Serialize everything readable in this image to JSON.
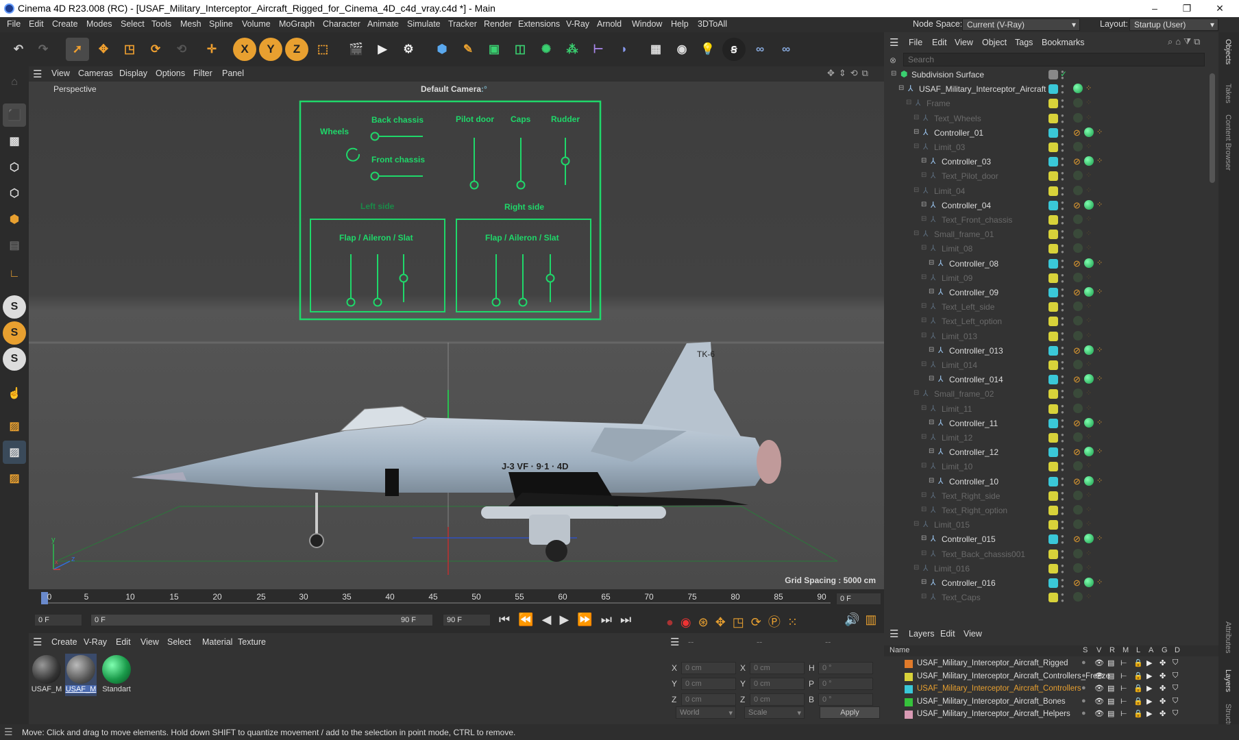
{
  "window": {
    "title": "Cinema 4D R23.008 (RC) - [USAF_Military_Interceptor_Aircraft_Rigged_for_Cinema_4D_c4d_vray.c4d *] - Main",
    "minimize": "–",
    "maximize": "❐",
    "close": "✕"
  },
  "menubar": {
    "items": [
      "File",
      "Edit",
      "Create",
      "Modes",
      "Select",
      "Tools",
      "Mesh",
      "Spline",
      "Volume",
      "MoGraph",
      "Character",
      "Animate",
      "Simulate",
      "Tracker",
      "Render",
      "Extensions",
      "V-Ray",
      "Arnold",
      "Window",
      "Help",
      "3DToAll"
    ],
    "node_space_label": "Node Space:",
    "node_space_value": "Current (V-Ray)",
    "layout_label": "Layout:",
    "layout_value": "Startup (User)"
  },
  "toolbar": {
    "axis_x": "X",
    "axis_y": "Y",
    "axis_z": "Z"
  },
  "lefttools": {
    "s1": "S",
    "s2": "S",
    "s3": "S"
  },
  "viewport": {
    "menu": [
      "View",
      "Cameras",
      "Display",
      "Options",
      "Filter",
      "Panel"
    ],
    "label": "Perspective",
    "camera": "Default Camera",
    "camera_suffix": ":°",
    "grid_spacing": "Grid Spacing : 5000 cm",
    "axis_y": "y",
    "axis_z": "z",
    "axis_x": "x",
    "rig": {
      "wheels": "Wheels",
      "back_chassis": "Back chassis",
      "front_chassis": "Front chassis",
      "pilot_door": "Pilot door",
      "caps": "Caps",
      "rudder": "Rudder",
      "left_side": "Left side",
      "right_side": "Right side",
      "flap_left": "Flap / Aileron / Slat",
      "flap_right": "Flap / Aileron / Slat"
    },
    "decals": {
      "tail": "TK-6",
      "fuselage": "J-3 VF · 9·1 · 4D"
    }
  },
  "timeline": {
    "ticks": [
      "0",
      "5",
      "10",
      "15",
      "20",
      "25",
      "30",
      "35",
      "40",
      "45",
      "50",
      "55",
      "60",
      "65",
      "70",
      "75",
      "80",
      "85",
      "90"
    ],
    "current_frame": "0 F"
  },
  "transport": {
    "start": "0 F",
    "range_start": "0 F",
    "range_end": "90 F",
    "end": "90 F"
  },
  "materials": {
    "menu": [
      "Create",
      "V-Ray",
      "Edit",
      "View",
      "Select",
      "Material",
      "Texture"
    ],
    "items": [
      "USAF_M",
      "USAF_M",
      "Standart"
    ]
  },
  "coords": {
    "header1": "--",
    "header2": "--",
    "header3": "--",
    "rows": [
      {
        "a": "X",
        "av": "0 cm",
        "b": "X",
        "bv": "0 cm",
        "c": "H",
        "cv": "0 °"
      },
      {
        "a": "Y",
        "av": "0 cm",
        "b": "Y",
        "bv": "0 cm",
        "c": "P",
        "cv": "0 °"
      },
      {
        "a": "Z",
        "av": "0 cm",
        "b": "Z",
        "bv": "0 cm",
        "c": "B",
        "cv": "0 °"
      }
    ],
    "world": "World",
    "scale": "Scale",
    "apply": "Apply"
  },
  "objects": {
    "menu": [
      "File",
      "Edit",
      "View",
      "Object",
      "Tags",
      "Bookmarks"
    ],
    "search_placeholder": "Search",
    "rows": [
      {
        "name": "Subdivision Surface",
        "indent": 0,
        "dim": false,
        "ctrl": false
      },
      {
        "name": "USAF_Military_Interceptor_Aircraft",
        "indent": 1,
        "dim": false,
        "ctrl": false
      },
      {
        "name": "Frame",
        "indent": 2,
        "dim": true,
        "ctrl": false
      },
      {
        "name": "Text_Wheels",
        "indent": 3,
        "dim": true,
        "ctrl": false
      },
      {
        "name": "Controller_01",
        "indent": 3,
        "dim": false,
        "ctrl": true
      },
      {
        "name": "Limit_03",
        "indent": 3,
        "dim": true,
        "ctrl": false
      },
      {
        "name": "Controller_03",
        "indent": 4,
        "dim": false,
        "ctrl": true
      },
      {
        "name": "Text_Pilot_door",
        "indent": 4,
        "dim": true,
        "ctrl": false
      },
      {
        "name": "Limit_04",
        "indent": 3,
        "dim": true,
        "ctrl": false
      },
      {
        "name": "Controller_04",
        "indent": 4,
        "dim": false,
        "ctrl": true
      },
      {
        "name": "Text_Front_chassis",
        "indent": 4,
        "dim": true,
        "ctrl": false
      },
      {
        "name": "Small_frame_01",
        "indent": 3,
        "dim": true,
        "ctrl": false
      },
      {
        "name": "Limit_08",
        "indent": 4,
        "dim": true,
        "ctrl": false
      },
      {
        "name": "Controller_08",
        "indent": 5,
        "dim": false,
        "ctrl": true
      },
      {
        "name": "Limit_09",
        "indent": 4,
        "dim": true,
        "ctrl": false
      },
      {
        "name": "Controller_09",
        "indent": 5,
        "dim": false,
        "ctrl": true
      },
      {
        "name": "Text_Left_side",
        "indent": 4,
        "dim": true,
        "ctrl": false
      },
      {
        "name": "Text_Left_option",
        "indent": 4,
        "dim": true,
        "ctrl": false
      },
      {
        "name": "Limit_013",
        "indent": 4,
        "dim": true,
        "ctrl": false
      },
      {
        "name": "Controller_013",
        "indent": 5,
        "dim": false,
        "ctrl": true
      },
      {
        "name": "Limit_014",
        "indent": 4,
        "dim": true,
        "ctrl": false
      },
      {
        "name": "Controller_014",
        "indent": 5,
        "dim": false,
        "ctrl": true
      },
      {
        "name": "Small_frame_02",
        "indent": 3,
        "dim": true,
        "ctrl": false
      },
      {
        "name": "Limit_11",
        "indent": 4,
        "dim": true,
        "ctrl": false
      },
      {
        "name": "Controller_11",
        "indent": 5,
        "dim": false,
        "ctrl": true
      },
      {
        "name": "Limit_12",
        "indent": 4,
        "dim": true,
        "ctrl": false
      },
      {
        "name": "Controller_12",
        "indent": 5,
        "dim": false,
        "ctrl": true
      },
      {
        "name": "Limit_10",
        "indent": 4,
        "dim": true,
        "ctrl": false
      },
      {
        "name": "Controller_10",
        "indent": 5,
        "dim": false,
        "ctrl": true
      },
      {
        "name": "Text_Right_side",
        "indent": 4,
        "dim": true,
        "ctrl": false
      },
      {
        "name": "Text_Right_option",
        "indent": 4,
        "dim": true,
        "ctrl": false
      },
      {
        "name": "Limit_015",
        "indent": 3,
        "dim": true,
        "ctrl": false
      },
      {
        "name": "Controller_015",
        "indent": 4,
        "dim": false,
        "ctrl": true
      },
      {
        "name": "Text_Back_chassis001",
        "indent": 4,
        "dim": true,
        "ctrl": false
      },
      {
        "name": "Limit_016",
        "indent": 3,
        "dim": true,
        "ctrl": false
      },
      {
        "name": "Controller_016",
        "indent": 4,
        "dim": false,
        "ctrl": true
      },
      {
        "name": "Text_Caps",
        "indent": 4,
        "dim": true,
        "ctrl": false
      }
    ]
  },
  "layers": {
    "menu": [
      "Layers",
      "Edit",
      "View"
    ],
    "name_header": "Name",
    "col_headers": [
      "S",
      "V",
      "R",
      "M",
      "L",
      "A",
      "G",
      "D"
    ],
    "rows": [
      {
        "name": "USAF_Military_Interceptor_Aircraft_Rigged",
        "color": "#e07a2a",
        "active": false
      },
      {
        "name": "USAF_Military_Interceptor_Aircraft_Controllers_Freeze",
        "color": "#d8d23a",
        "active": false
      },
      {
        "name": "USAF_Military_Interceptor_Aircraft_Controllers",
        "color": "#3ac8d8",
        "active": true
      },
      {
        "name": "USAF_Military_Interceptor_Aircraft_Bones",
        "color": "#36c23c",
        "active": false
      },
      {
        "name": "USAF_Military_Interceptor_Aircraft_Helpers",
        "color": "#d89ab4",
        "active": false
      }
    ]
  },
  "sidetabs": [
    "Objects",
    "Takes",
    "Content Browser",
    "Attributes",
    "Layers",
    "Structure"
  ],
  "status": "Move: Click and drag to move elements. Hold down SHIFT to quantize movement / add to the selection in point mode, CTRL to remove."
}
